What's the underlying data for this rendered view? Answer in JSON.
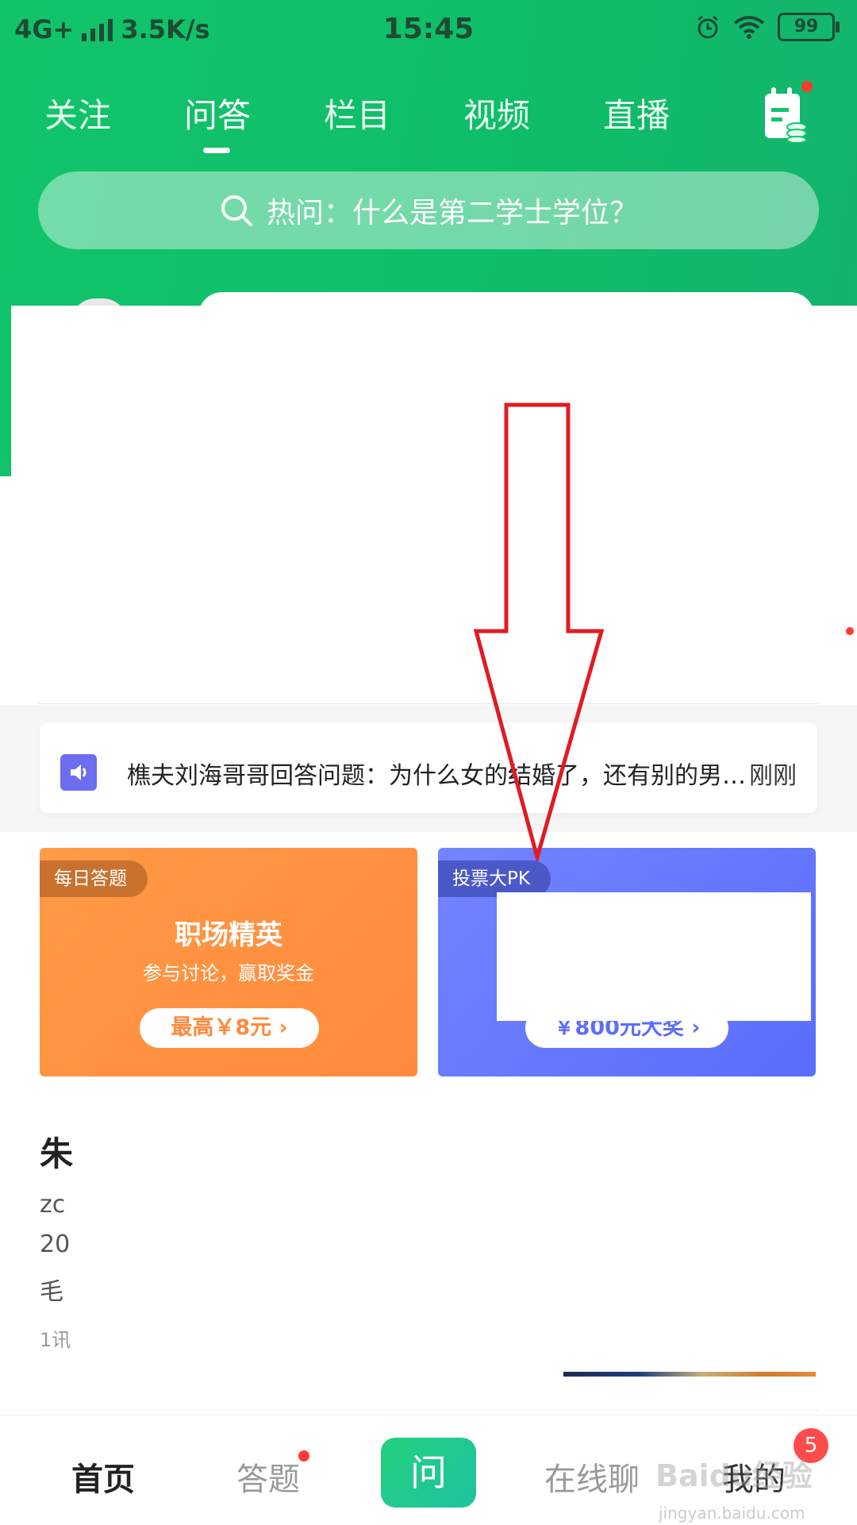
{
  "status_bar": {
    "network": "4G+",
    "speed": "3.5K/s",
    "time": "15:45",
    "battery": "99"
  },
  "top_tabs": [
    "关注",
    "问答",
    "栏目",
    "视频",
    "直播"
  ],
  "active_tab": "问答",
  "search": {
    "placeholder": "热问：什么是第二学士学位？"
  },
  "ticker": {
    "text": "樵夫刘海哥哥回答问题：为什么女的结婚了，还有别的男…",
    "time": "刚刚"
  },
  "promos": [
    {
      "tag": "每日答题",
      "title": "职场精英",
      "subtitle": "参与讨论，赢取奖金",
      "button": "最高￥8元 ›"
    },
    {
      "tag": "投票大PK",
      "button": "￥800元大奖 ›"
    }
  ],
  "feed": {
    "title": "朱",
    "lines": [
      "zc",
      "20",
      "毛",
      "1讯"
    ]
  },
  "bottom_nav": {
    "home": "首页",
    "answer": "答题",
    "ask": "问",
    "chat": "在线聊",
    "mine": "我的",
    "mine_badge": "5"
  },
  "watermark": {
    "brand": "Baidu经验",
    "url": "jingyan.baidu.com"
  },
  "colors": {
    "brand_green": "#11c46a",
    "promo_orange": "#ff8a3c",
    "promo_blue": "#5a6dfb",
    "badge_red": "#ff4b4b",
    "arrow_red": "#e11b22"
  }
}
